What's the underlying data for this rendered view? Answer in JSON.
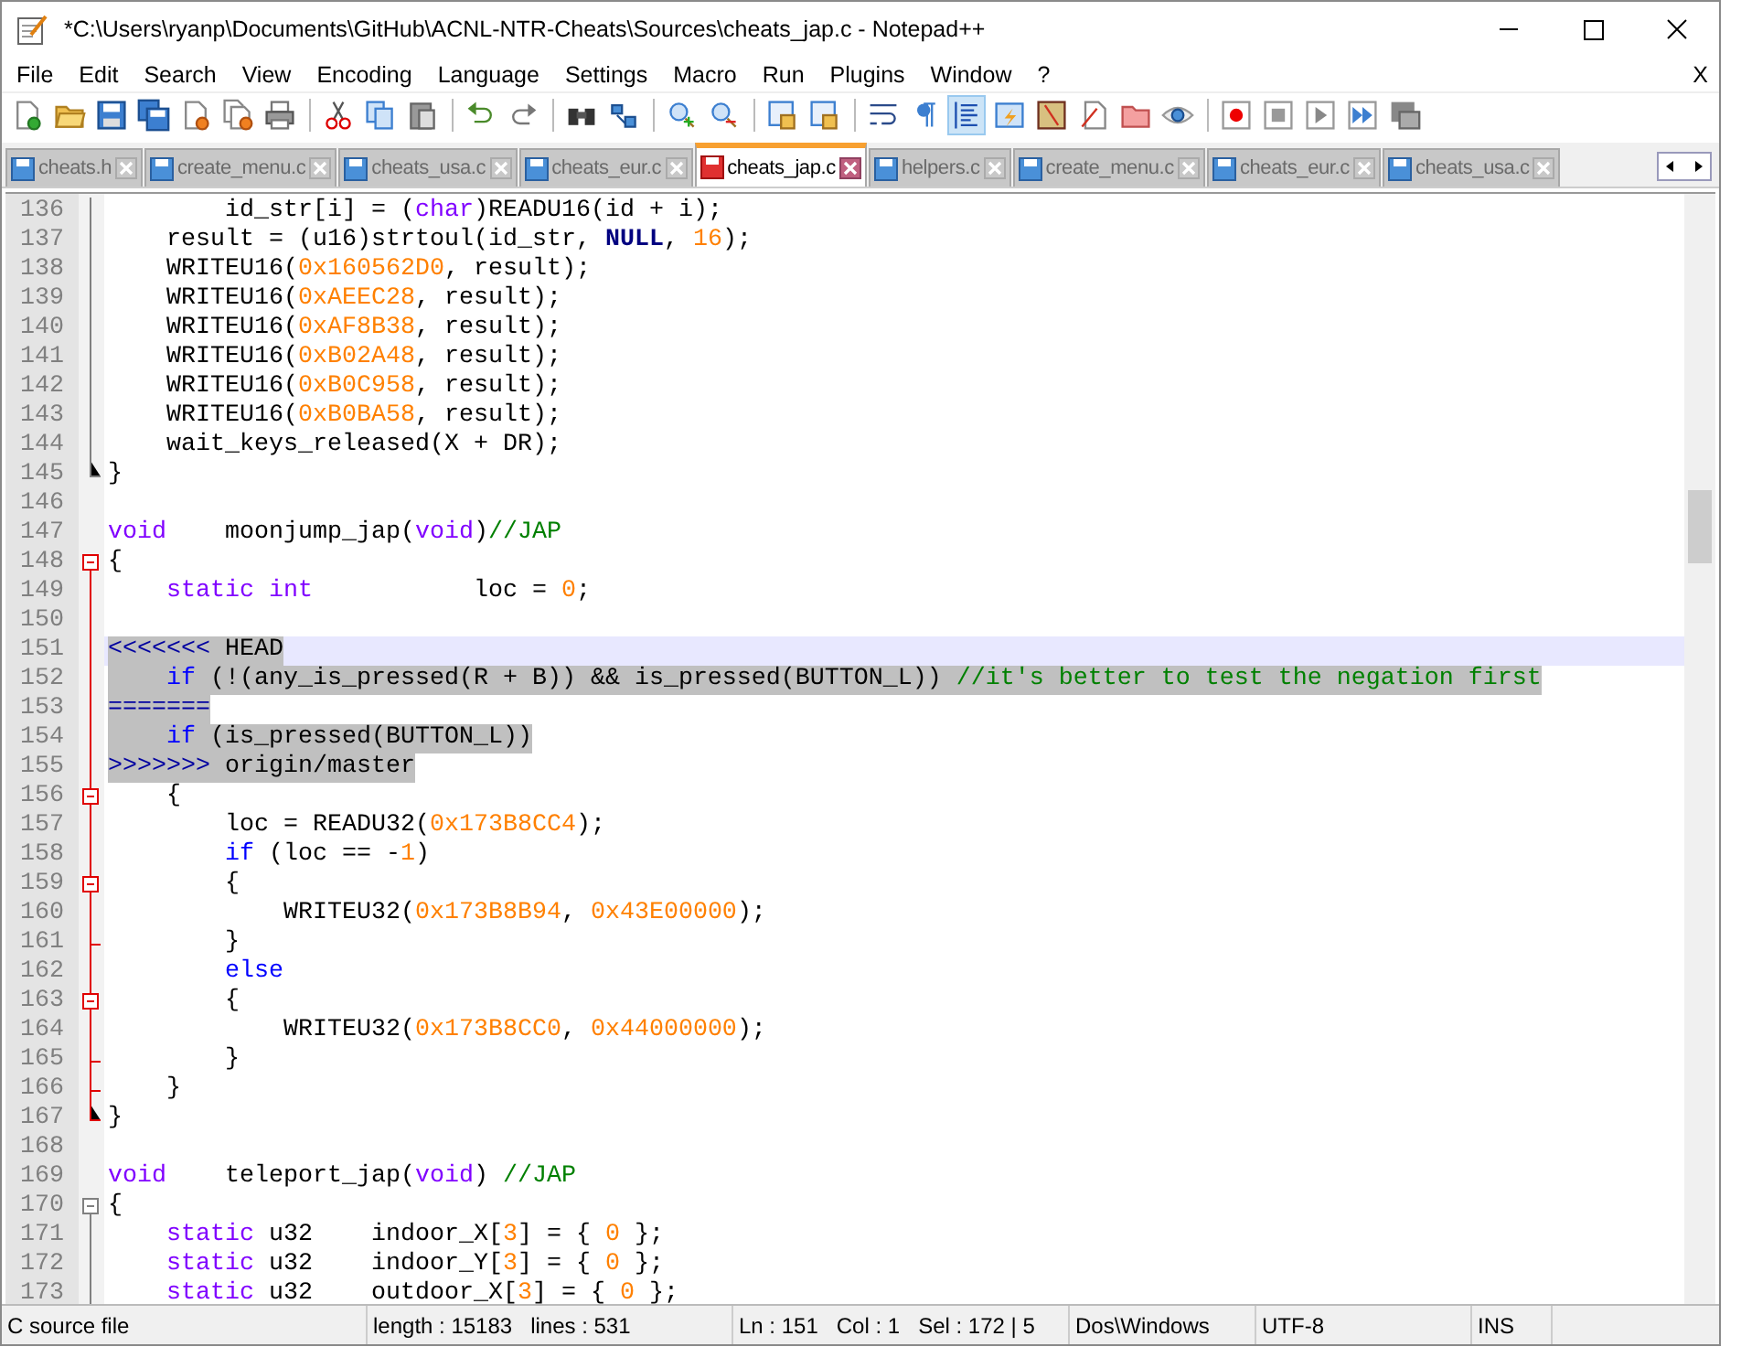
{
  "window": {
    "title": "*C:\\Users\\ryanp\\Documents\\GitHub\\ACNL-NTR-Cheats\\Sources\\cheats_jap.c - Notepad++"
  },
  "menu": [
    "File",
    "Edit",
    "Search",
    "View",
    "Encoding",
    "Language",
    "Settings",
    "Macro",
    "Run",
    "Plugins",
    "Window",
    "?"
  ],
  "menu_close": "X",
  "toolbar": [
    {
      "kind": "button",
      "pressed": false
    },
    {
      "kind": "button",
      "pressed": false
    },
    {
      "kind": "button",
      "pressed": false
    },
    {
      "kind": "button",
      "pressed": false
    },
    {
      "kind": "button",
      "pressed": false
    },
    {
      "kind": "button",
      "pressed": false
    },
    {
      "kind": "button",
      "pressed": false
    },
    {
      "kind": "separator"
    },
    {
      "kind": "button",
      "pressed": false
    },
    {
      "kind": "button",
      "pressed": false
    },
    {
      "kind": "button",
      "pressed": false
    },
    {
      "kind": "separator"
    },
    {
      "kind": "button",
      "pressed": false
    },
    {
      "kind": "button",
      "pressed": false
    },
    {
      "kind": "separator"
    },
    {
      "kind": "button",
      "pressed": false
    },
    {
      "kind": "button",
      "pressed": false
    },
    {
      "kind": "separator"
    },
    {
      "kind": "button",
      "pressed": false
    },
    {
      "kind": "button",
      "pressed": false
    },
    {
      "kind": "separator"
    },
    {
      "kind": "button",
      "pressed": false
    },
    {
      "kind": "button",
      "pressed": false
    },
    {
      "kind": "separator"
    },
    {
      "kind": "button",
      "pressed": false
    },
    {
      "kind": "button",
      "pressed": false
    },
    {
      "kind": "button",
      "pressed": true
    },
    {
      "kind": "button",
      "pressed": false
    },
    {
      "kind": "button",
      "pressed": false
    },
    {
      "kind": "button",
      "pressed": false
    },
    {
      "kind": "button",
      "pressed": false
    },
    {
      "kind": "button",
      "pressed": false
    },
    {
      "kind": "separator"
    },
    {
      "kind": "button",
      "pressed": false
    },
    {
      "kind": "button",
      "pressed": false
    },
    {
      "kind": "button",
      "pressed": false
    },
    {
      "kind": "button",
      "pressed": false
    },
    {
      "kind": "button",
      "pressed": false
    }
  ],
  "tabs": [
    {
      "label": "cheats.h",
      "selected": false,
      "modified": false
    },
    {
      "label": "create_menu.c",
      "selected": false,
      "modified": false
    },
    {
      "label": "cheats_usa.c",
      "selected": false,
      "modified": false
    },
    {
      "label": "cheats_eur.c",
      "selected": false,
      "modified": false
    },
    {
      "label": "cheats_jap.c",
      "selected": true,
      "modified": true
    },
    {
      "label": "helpers.c",
      "selected": false,
      "modified": false
    },
    {
      "label": "create_menu.c",
      "selected": false,
      "modified": false
    },
    {
      "label": "cheats_eur.c",
      "selected": false,
      "modified": false
    },
    {
      "label": "cheats_usa.c",
      "selected": false,
      "modified": false
    }
  ],
  "editor": {
    "lines": [
      {
        "number": "136",
        "fold": {
          "kind": "line",
          "active": false
        },
        "selected": false,
        "current": false,
        "tokens": [
          {
            "kind": "plain",
            "text": "        id_str[i] = ("
          },
          {
            "kind": "type",
            "text": "char"
          },
          {
            "kind": "plain",
            "text": ")READU16(id + i);"
          }
        ]
      },
      {
        "number": "137",
        "fold": {
          "kind": "line",
          "active": false
        },
        "selected": false,
        "current": false,
        "tokens": [
          {
            "kind": "plain",
            "text": "    result = (u16)strtoul(id_str, "
          },
          {
            "kind": "constant",
            "text": "NULL"
          },
          {
            "kind": "plain",
            "text": ", "
          },
          {
            "kind": "number",
            "text": "16"
          },
          {
            "kind": "plain",
            "text": ");"
          }
        ]
      },
      {
        "number": "138",
        "fold": {
          "kind": "line",
          "active": false
        },
        "selected": false,
        "current": false,
        "tokens": [
          {
            "kind": "plain",
            "text": "    WRITEU16("
          },
          {
            "kind": "number",
            "text": "0x160562D0"
          },
          {
            "kind": "plain",
            "text": ", result);"
          }
        ]
      },
      {
        "number": "139",
        "fold": {
          "kind": "line",
          "active": false
        },
        "selected": false,
        "current": false,
        "tokens": [
          {
            "kind": "plain",
            "text": "    WRITEU16("
          },
          {
            "kind": "number",
            "text": "0xAEEC28"
          },
          {
            "kind": "plain",
            "text": ", result);"
          }
        ]
      },
      {
        "number": "140",
        "fold": {
          "kind": "line",
          "active": false
        },
        "selected": false,
        "current": false,
        "tokens": [
          {
            "kind": "plain",
            "text": "    WRITEU16("
          },
          {
            "kind": "number",
            "text": "0xAF8B38"
          },
          {
            "kind": "plain",
            "text": ", result);"
          }
        ]
      },
      {
        "number": "141",
        "fold": {
          "kind": "line",
          "active": false
        },
        "selected": false,
        "current": false,
        "tokens": [
          {
            "kind": "plain",
            "text": "    WRITEU16("
          },
          {
            "kind": "number",
            "text": "0xB02A48"
          },
          {
            "kind": "plain",
            "text": ", result);"
          }
        ]
      },
      {
        "number": "142",
        "fold": {
          "kind": "line",
          "active": false
        },
        "selected": false,
        "current": false,
        "tokens": [
          {
            "kind": "plain",
            "text": "    WRITEU16("
          },
          {
            "kind": "number",
            "text": "0xB0C958"
          },
          {
            "kind": "plain",
            "text": ", result);"
          }
        ]
      },
      {
        "number": "143",
        "fold": {
          "kind": "line",
          "active": false
        },
        "selected": false,
        "current": false,
        "tokens": [
          {
            "kind": "plain",
            "text": "    WRITEU16("
          },
          {
            "kind": "number",
            "text": "0xB0BA58"
          },
          {
            "kind": "plain",
            "text": ", result);"
          }
        ]
      },
      {
        "number": "144",
        "fold": {
          "kind": "line",
          "active": false
        },
        "selected": false,
        "current": false,
        "tokens": [
          {
            "kind": "plain",
            "text": "    wait_keys_released(X + DR);"
          }
        ]
      },
      {
        "number": "145",
        "fold": {
          "kind": "end",
          "active": false
        },
        "selected": false,
        "current": false,
        "tokens": [
          {
            "kind": "plain",
            "text": "}"
          }
        ]
      },
      {
        "number": "146",
        "selected": false,
        "current": false
      },
      {
        "number": "147",
        "selected": false,
        "current": false,
        "tokens": [
          {
            "kind": "type",
            "text": "void"
          },
          {
            "kind": "plain",
            "text": "    moonjump_jap("
          },
          {
            "kind": "type",
            "text": "void"
          },
          {
            "kind": "plain",
            "text": ")"
          },
          {
            "kind": "comment",
            "text": "//JAP"
          }
        ]
      },
      {
        "number": "148",
        "fold": {
          "kind": "box",
          "active": true
        },
        "selected": false,
        "current": false,
        "tokens": [
          {
            "kind": "plain",
            "text": "{"
          }
        ]
      },
      {
        "number": "149",
        "fold": {
          "kind": "line",
          "active": true
        },
        "selected": false,
        "current": false,
        "tokens": [
          {
            "kind": "type",
            "text": "    static int"
          },
          {
            "kind": "plain",
            "text": "           loc = "
          },
          {
            "kind": "number",
            "text": "0"
          },
          {
            "kind": "plain",
            "text": ";"
          }
        ]
      },
      {
        "number": "150",
        "fold": {
          "kind": "line",
          "active": true
        },
        "selected": false,
        "current": false
      },
      {
        "number": "151",
        "fold": {
          "kind": "line",
          "active": true
        },
        "selected": true,
        "current": true,
        "tokens": [
          {
            "kind": "marker",
            "text": "<<<<<<<"
          },
          {
            "kind": "plain",
            "text": " HEAD"
          }
        ]
      },
      {
        "number": "152",
        "fold": {
          "kind": "line",
          "active": true
        },
        "selected": true,
        "current": false,
        "tokens": [
          {
            "kind": "flow",
            "text": "    if"
          },
          {
            "kind": "plain",
            "text": " (!(any_is_pressed(R + B)) && is_pressed(BUTTON_L)) "
          },
          {
            "kind": "comment",
            "text": "//it's better to test the negation first"
          }
        ]
      },
      {
        "number": "153",
        "fold": {
          "kind": "line",
          "active": true
        },
        "selected": true,
        "current": false,
        "tokens": [
          {
            "kind": "marker",
            "text": "======="
          }
        ]
      },
      {
        "number": "154",
        "fold": {
          "kind": "line",
          "active": true
        },
        "selected": true,
        "current": false,
        "tokens": [
          {
            "kind": "flow",
            "text": "    if"
          },
          {
            "kind": "plain",
            "text": " (is_pressed(BUTTON_L))"
          }
        ]
      },
      {
        "number": "155",
        "fold": {
          "kind": "line",
          "active": true
        },
        "selected": true,
        "current": false,
        "tokens": [
          {
            "kind": "marker",
            "text": ">>>>>>>"
          },
          {
            "kind": "plain",
            "text": " origin/master"
          }
        ]
      },
      {
        "number": "156",
        "fold": {
          "kind": "inner-box",
          "active": true
        },
        "selected": false,
        "current": false,
        "tokens": [
          {
            "kind": "plain",
            "text": "    {"
          }
        ]
      },
      {
        "number": "157",
        "fold": {
          "kind": "line",
          "active": true
        },
        "selected": false,
        "current": false,
        "tokens": [
          {
            "kind": "plain",
            "text": "        loc = READU32("
          },
          {
            "kind": "number",
            "text": "0x173B8CC4"
          },
          {
            "kind": "plain",
            "text": ");"
          }
        ]
      },
      {
        "number": "158",
        "fold": {
          "kind": "line",
          "active": true
        },
        "selected": false,
        "current": false,
        "tokens": [
          {
            "kind": "flow",
            "text": "        if"
          },
          {
            "kind": "plain",
            "text": " (loc == -"
          },
          {
            "kind": "number",
            "text": "1"
          },
          {
            "kind": "plain",
            "text": ")"
          }
        ]
      },
      {
        "number": "159",
        "fold": {
          "kind": "inner-box",
          "active": true
        },
        "selected": false,
        "current": false,
        "tokens": [
          {
            "kind": "plain",
            "text": "        {"
          }
        ]
      },
      {
        "number": "160",
        "fold": {
          "kind": "line",
          "active": true
        },
        "selected": false,
        "current": false,
        "tokens": [
          {
            "kind": "plain",
            "text": "            WRITEU32("
          },
          {
            "kind": "number",
            "text": "0x173B8B94"
          },
          {
            "kind": "plain",
            "text": ", "
          },
          {
            "kind": "number",
            "text": "0x43E00000"
          },
          {
            "kind": "plain",
            "text": ");"
          }
        ]
      },
      {
        "number": "161",
        "fold": {
          "kind": "tick",
          "active": true
        },
        "selected": false,
        "current": false,
        "tokens": [
          {
            "kind": "plain",
            "text": "        }"
          }
        ]
      },
      {
        "number": "162",
        "fold": {
          "kind": "line",
          "active": true
        },
        "selected": false,
        "current": false,
        "tokens": [
          {
            "kind": "flow",
            "text": "        else"
          }
        ]
      },
      {
        "number": "163",
        "fold": {
          "kind": "inner-box",
          "active": true
        },
        "selected": false,
        "current": false,
        "tokens": [
          {
            "kind": "plain",
            "text": "        {"
          }
        ]
      },
      {
        "number": "164",
        "fold": {
          "kind": "line",
          "active": true
        },
        "selected": false,
        "current": false,
        "tokens": [
          {
            "kind": "plain",
            "text": "            WRITEU32("
          },
          {
            "kind": "number",
            "text": "0x173B8CC0"
          },
          {
            "kind": "plain",
            "text": ", "
          },
          {
            "kind": "number",
            "text": "0x44000000"
          },
          {
            "kind": "plain",
            "text": ");"
          }
        ]
      },
      {
        "number": "165",
        "fold": {
          "kind": "tick",
          "active": true
        },
        "selected": false,
        "current": false,
        "tokens": [
          {
            "kind": "plain",
            "text": "        }"
          }
        ]
      },
      {
        "number": "166",
        "fold": {
          "kind": "tick",
          "active": true
        },
        "selected": false,
        "current": false,
        "tokens": [
          {
            "kind": "plain",
            "text": "    }"
          }
        ]
      },
      {
        "number": "167",
        "fold": {
          "kind": "end",
          "active": true
        },
        "selected": false,
        "current": false,
        "tokens": [
          {
            "kind": "plain",
            "text": "}"
          }
        ]
      },
      {
        "number": "168",
        "selected": false,
        "current": false
      },
      {
        "number": "169",
        "selected": false,
        "current": false,
        "tokens": [
          {
            "kind": "type",
            "text": "void"
          },
          {
            "kind": "plain",
            "text": "    teleport_jap("
          },
          {
            "kind": "type",
            "text": "void"
          },
          {
            "kind": "plain",
            "text": ") "
          },
          {
            "kind": "comment",
            "text": "//JAP"
          }
        ]
      },
      {
        "number": "170",
        "fold": {
          "kind": "box",
          "active": false
        },
        "selected": false,
        "current": false,
        "tokens": [
          {
            "kind": "plain",
            "text": "{"
          }
        ]
      },
      {
        "number": "171",
        "fold": {
          "kind": "line",
          "active": false
        },
        "selected": false,
        "current": false,
        "tokens": [
          {
            "kind": "type",
            "text": "    static"
          },
          {
            "kind": "plain",
            "text": " u32    indoor_X["
          },
          {
            "kind": "number",
            "text": "3"
          },
          {
            "kind": "plain",
            "text": "] = { "
          },
          {
            "kind": "number",
            "text": "0"
          },
          {
            "kind": "plain",
            "text": " };"
          }
        ]
      },
      {
        "number": "172",
        "fold": {
          "kind": "line",
          "active": false
        },
        "selected": false,
        "current": false,
        "tokens": [
          {
            "kind": "type",
            "text": "    static"
          },
          {
            "kind": "plain",
            "text": " u32    indoor_Y["
          },
          {
            "kind": "number",
            "text": "3"
          },
          {
            "kind": "plain",
            "text": "] = { "
          },
          {
            "kind": "number",
            "text": "0"
          },
          {
            "kind": "plain",
            "text": " };"
          }
        ]
      },
      {
        "number": "173",
        "fold": {
          "kind": "line",
          "active": false
        },
        "selected": false,
        "current": false,
        "tokens": [
          {
            "kind": "type",
            "text": "    static"
          },
          {
            "kind": "plain",
            "text": " u32    outdoor_X["
          },
          {
            "kind": "number",
            "text": "3"
          },
          {
            "kind": "plain",
            "text": "] = { "
          },
          {
            "kind": "number",
            "text": "0"
          },
          {
            "kind": "plain",
            "text": " };"
          }
        ]
      }
    ]
  },
  "status_bar": {
    "file_type": "C source file",
    "length": "length : 15183",
    "lines": "lines : 531",
    "line": "Ln : 151",
    "column": "Col : 1",
    "selection": "Sel : 172 | 5",
    "eol": "Dos\\Windows",
    "encoding": "UTF-8",
    "mode": "INS"
  }
}
